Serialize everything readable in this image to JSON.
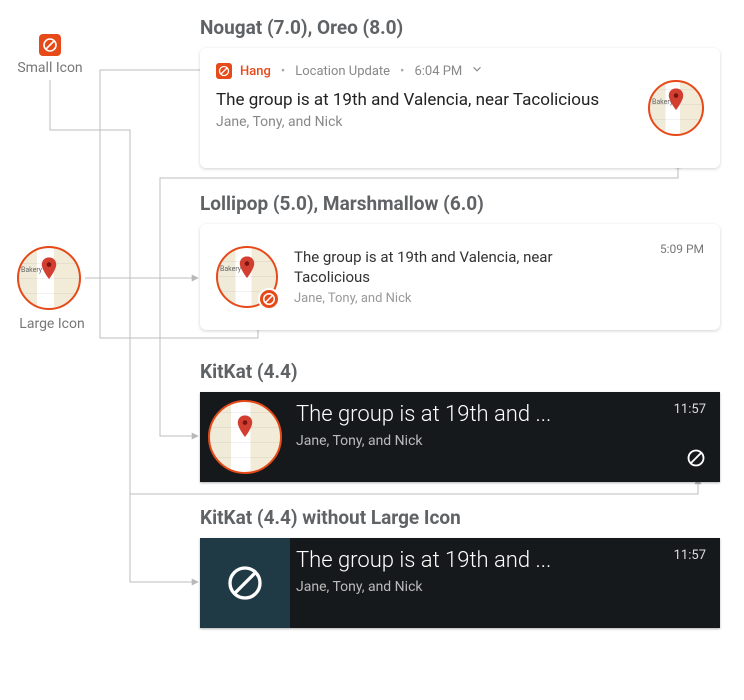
{
  "icons": {
    "small_icon_name": "app-small-icon",
    "large_icon_name": "map-avatar-icon"
  },
  "labels": {
    "small_icon": "Small Icon",
    "large_icon": "Large Icon"
  },
  "sections": {
    "nougat_oreo": {
      "heading": "Nougat (7.0), Oreo (8.0)",
      "app_name": "Hang",
      "category": "Location Update",
      "time": "6:04 PM",
      "title": "The group is at 19th and Valencia, near Tacolicious",
      "subtitle": "Jane, Tony, and Nick",
      "avatar_label": "Bakery"
    },
    "lollipop_marshmallow": {
      "heading": "Lollipop (5.0), Marshmallow (6.0)",
      "title": "The group is at 19th and Valencia, near Tacolicious",
      "subtitle": "Jane, Tony, and Nick",
      "time": "5:09 PM",
      "avatar_label": "Bakery"
    },
    "kitkat": {
      "heading": "KitKat (4.4)",
      "title": "The group is at 19th and ...",
      "subtitle": "Jane, Tony, and Nick",
      "time": "11:57"
    },
    "kitkat_no_large": {
      "heading": "KitKat (4.4) without Large Icon",
      "title": "The group is at 19th and ...",
      "subtitle": "Jane, Tony, and Nick",
      "time": "11:57"
    }
  },
  "left_avatar_label": "Bakery"
}
